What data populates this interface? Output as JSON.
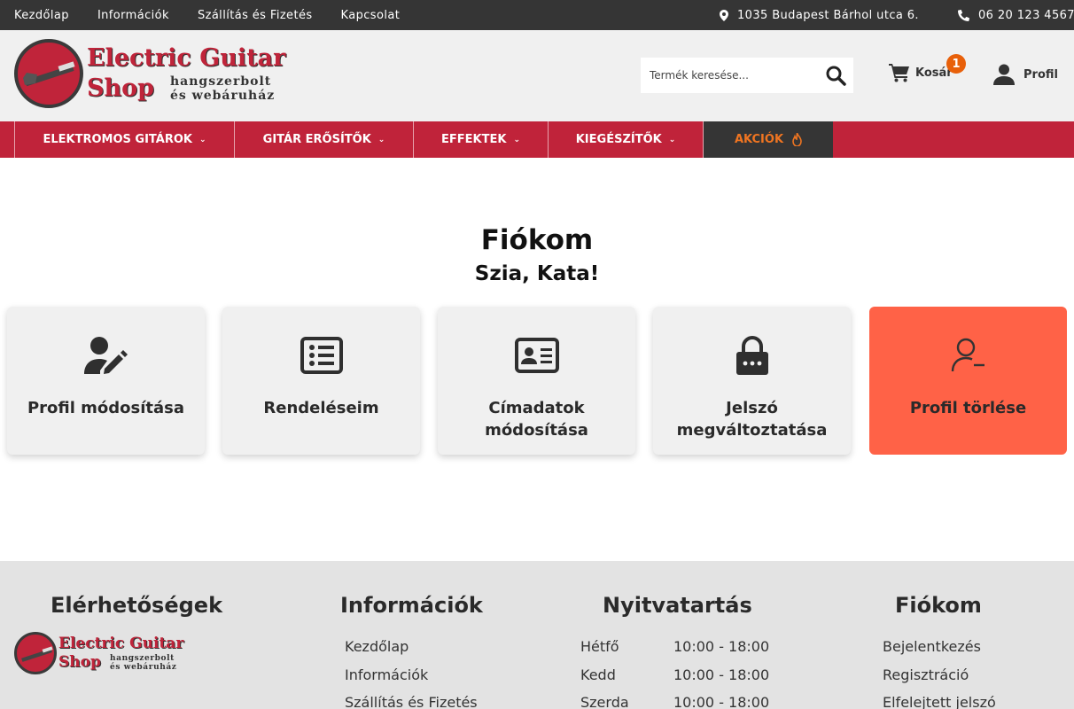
{
  "topbar": {
    "links": [
      "Kezdőlap",
      "Információk",
      "Szállítás és Fizetés",
      "Kapcsolat"
    ],
    "address": "1035 Budapest Bárhol utca 6.",
    "phone": "06 20 123 4567"
  },
  "logo": {
    "line1": "Electric Guitar",
    "line2": "Shop",
    "sub1": "hangszerbolt",
    "sub2": "és webáruház"
  },
  "search": {
    "placeholder": "Termék keresése..."
  },
  "cart": {
    "label": "Kosár",
    "count": "1"
  },
  "profile": {
    "label": "Profil"
  },
  "nav": {
    "items": [
      "ELEKTROMOS GITÁROK",
      "GITÁR ERŐSÍTŐK",
      "EFFEKTEK",
      "KIEGÉSZÍTŐK"
    ],
    "sale": "AKCIÓK"
  },
  "page": {
    "title": "Fiókom",
    "greeting": "Szia, Kata!"
  },
  "cards": [
    {
      "label": "Profil módosítása",
      "icon": "user-edit-icon"
    },
    {
      "label": "Rendeléseim",
      "icon": "list-icon"
    },
    {
      "label": "Címadatok módosítása",
      "icon": "address-card-icon"
    },
    {
      "label": "Jelszó megváltoztatása",
      "icon": "lock-icon"
    },
    {
      "label": "Profil törlése",
      "icon": "user-minus-icon"
    }
  ],
  "footer": {
    "contacts_title": "Elérhetőségek",
    "info_title": "Információk",
    "info_links": [
      "Kezdőlap",
      "Információk",
      "Szállítás és Fizetés"
    ],
    "hours_title": "Nyitvatartás",
    "hours": [
      {
        "day": "Hétfő",
        "time": "10:00 - 18:00"
      },
      {
        "day": "Kedd",
        "time": "10:00 - 18:00"
      },
      {
        "day": "Szerda",
        "time": "10:00 - 18:00"
      }
    ],
    "account_title": "Fiókom",
    "account_links": [
      "Bejelentkezés",
      "Regisztráció",
      "Elfelejtett jelszó"
    ]
  },
  "colors": {
    "brand_red": "#c0233a",
    "sale_orange": "#f07521",
    "danger": "#ff6247",
    "dark": "#353535"
  }
}
